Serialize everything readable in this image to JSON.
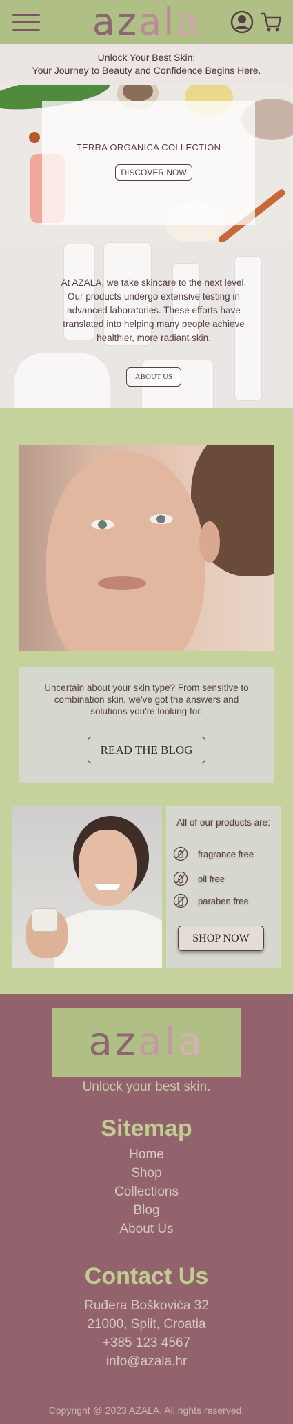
{
  "header": {
    "logo_letters": [
      "az",
      "al",
      "a"
    ],
    "menu_icon": "hamburger-menu-icon",
    "user_icon": "user-account-icon",
    "cart_icon": "shopping-cart-icon"
  },
  "tagline": {
    "line1": "Unlock Your Best Skin:",
    "line2": "Your Journey to Beauty and Confidence Begins Here."
  },
  "hero": {
    "title": "TERRA ORGANICA COLLECTION",
    "button": "DISCOVER NOW"
  },
  "about": {
    "text": "At AZALA, we take skincare to the next level. Our products undergo extensive testing in advanced laboratories. These efforts have translated into helping many people achieve healthier, more radiant skin.",
    "button": "ABOUT US"
  },
  "blog": {
    "text": "Uncertain about your skin type? From sensitive to combination skin, we've got the answers and solutions you're looking for.",
    "button": "READ THE BLOG"
  },
  "product": {
    "title": "All of our products are:",
    "features": [
      {
        "icon": "fragrance-free-icon",
        "label": "fragrance free"
      },
      {
        "icon": "oil-free-icon",
        "label": "oil free"
      },
      {
        "icon": "paraben-free-icon",
        "label": "paraben free"
      }
    ],
    "button": "SHOP NOW"
  },
  "footer": {
    "logo_letters": [
      "az",
      "al",
      "a"
    ],
    "tagline": "Unlock your best skin.",
    "sitemap_heading": "Sitemap",
    "sitemap": [
      "Home",
      "Shop",
      "Collections",
      "Blog",
      "About Us"
    ],
    "contact_heading": "Contact Us",
    "contact": [
      "Ruđera Boškovića 32",
      "21000, Split, Croatia",
      "+385 123 4567",
      "info@azala.hr"
    ],
    "copyright": "Copyright @ 2023 AZALA. All rights reserved."
  },
  "colors": {
    "header_green": "#afbf86",
    "page_green": "#c6d29b",
    "footer_mauve": "#93636d",
    "text_plum": "#5b3d45"
  }
}
